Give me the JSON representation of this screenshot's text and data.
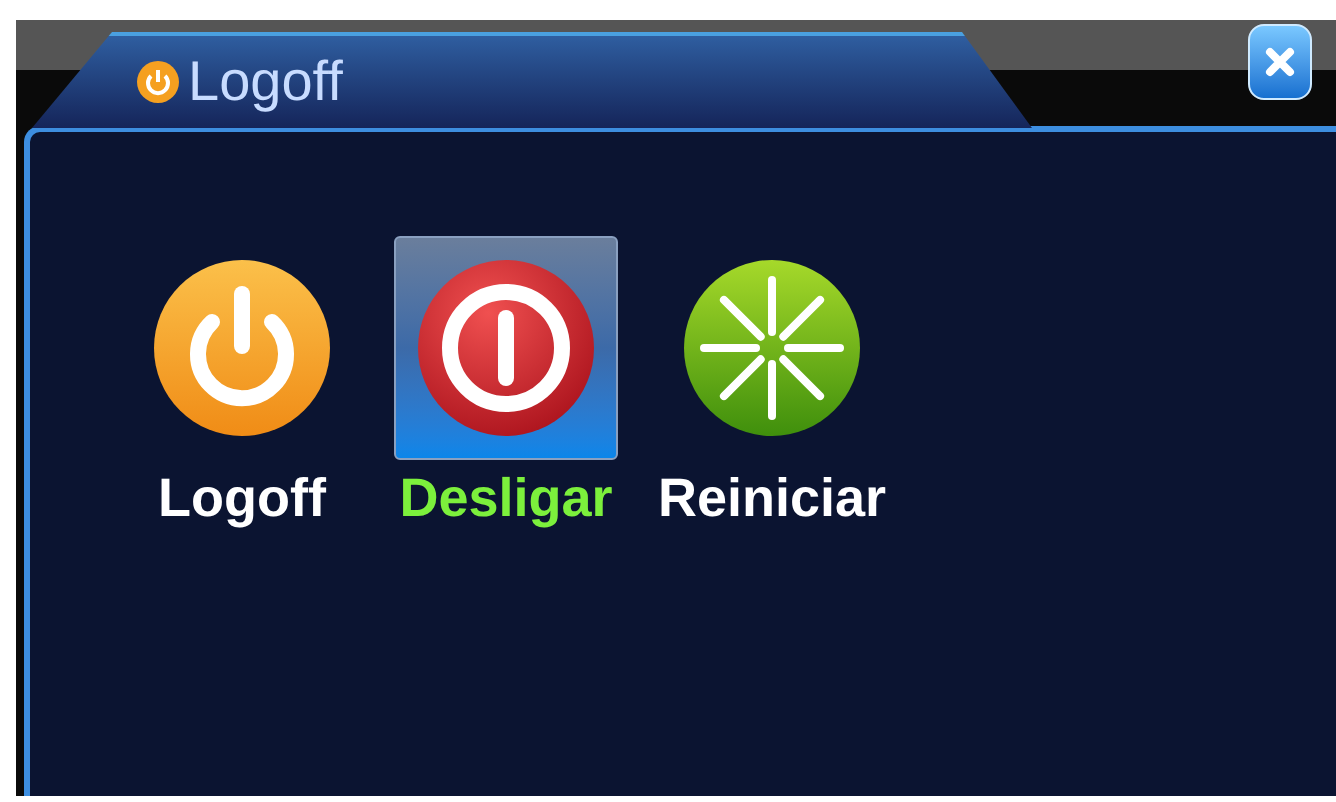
{
  "window": {
    "title": "Logoff"
  },
  "options": [
    {
      "label": "Logoff",
      "kind": "logoff",
      "selected": false
    },
    {
      "label": "Desligar",
      "kind": "shutdown",
      "selected": true
    },
    {
      "label": "Reiniciar",
      "kind": "restart",
      "selected": false
    }
  ]
}
